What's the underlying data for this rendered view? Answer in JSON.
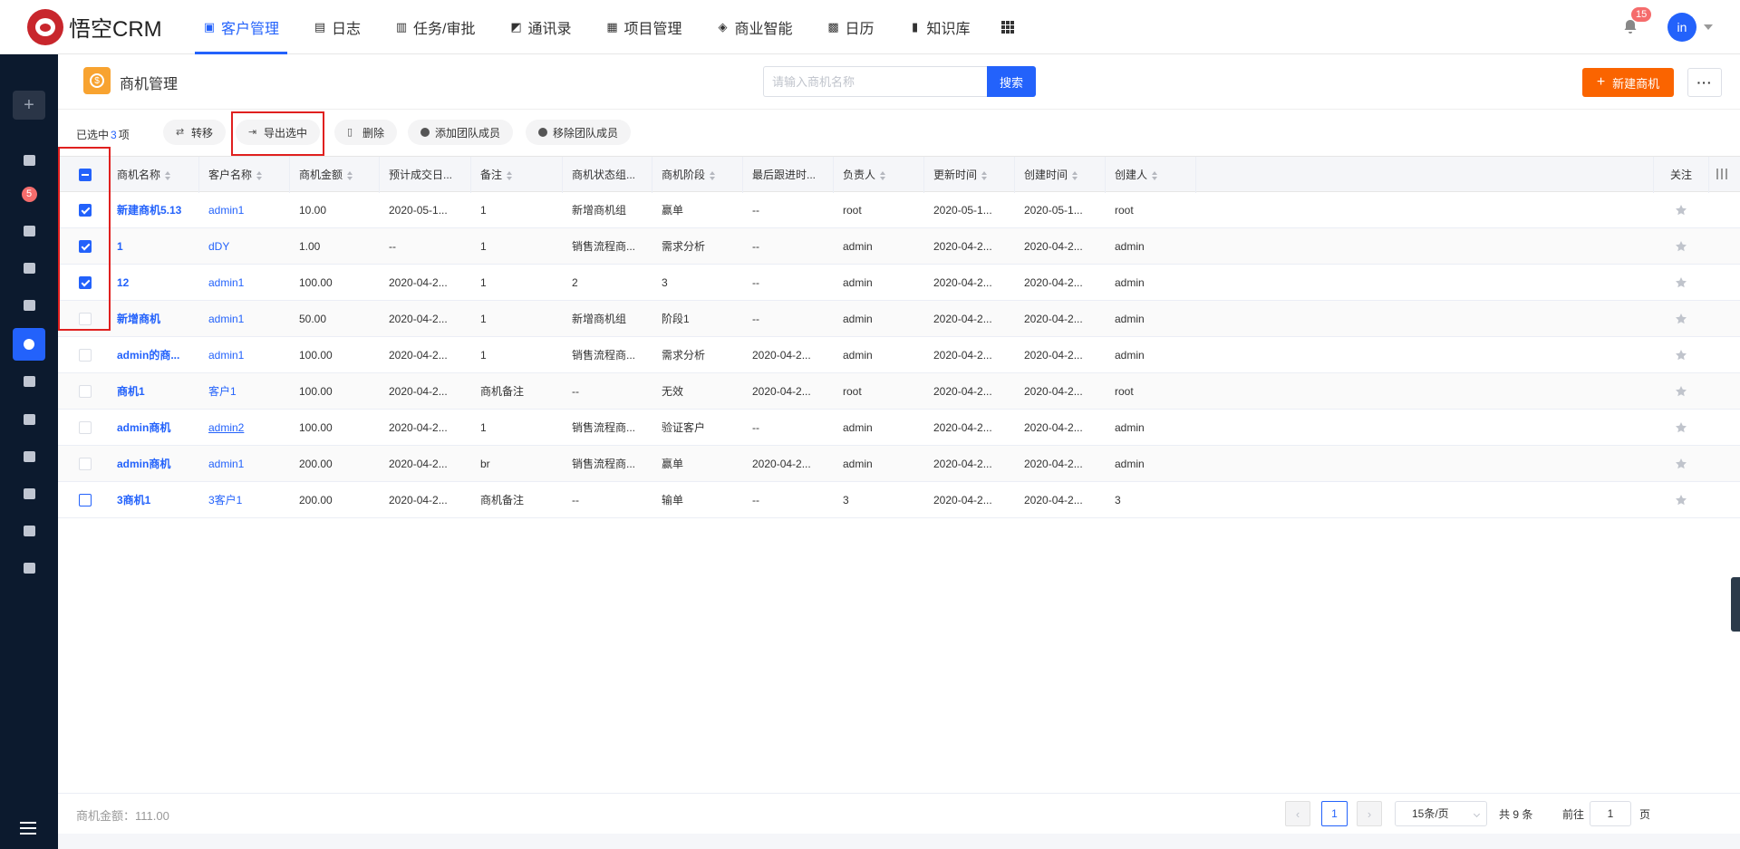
{
  "app": {
    "logo_text": "悟空CRM"
  },
  "nav": {
    "items": [
      {
        "label": "客户管理",
        "icon": "customer-icon",
        "active": true
      },
      {
        "label": "日志",
        "icon": "log-icon"
      },
      {
        "label": "任务/审批",
        "icon": "briefcase-icon"
      },
      {
        "label": "通讯录",
        "icon": "phone-book-icon"
      },
      {
        "label": "项目管理",
        "icon": "project-icon"
      },
      {
        "label": "商业智能",
        "icon": "bi-icon"
      },
      {
        "label": "日历",
        "icon": "calendar-icon"
      },
      {
        "label": "知识库",
        "icon": "book-icon"
      }
    ],
    "notification_count": "15",
    "avatar_text": "in"
  },
  "sidebar": {
    "add_label": "+",
    "badge_count": "5"
  },
  "header": {
    "title": "商机管理",
    "search_placeholder": "请输入商机名称",
    "search_button": "搜索",
    "new_button": "新建商机",
    "more_button": "···"
  },
  "toolbar": {
    "selected_prefix": "已选中",
    "selected_count": "3",
    "selected_suffix": "项",
    "buttons": [
      "转移",
      "导出选中",
      "删除",
      "添加团队成员",
      "移除团队成员"
    ]
  },
  "table": {
    "columns": [
      "商机名称",
      "客户名称",
      "商机金额",
      "预计成交日...",
      "备注",
      "商机状态组...",
      "商机阶段",
      "最后跟进时...",
      "负责人",
      "更新时间",
      "创建时间",
      "创建人",
      "关注"
    ],
    "rows": [
      {
        "checked": true,
        "cells": [
          "新建商机5.13",
          "admin1",
          "10.00",
          "2020-05-1...",
          "1",
          "新增商机组",
          "赢单",
          "--",
          "root",
          "2020-05-1...",
          "2020-05-1...",
          "root"
        ]
      },
      {
        "checked": true,
        "cells": [
          "1",
          "dDY",
          "1.00",
          "--",
          "1",
          "销售流程商...",
          "需求分析",
          "--",
          "admin",
          "2020-04-2...",
          "2020-04-2...",
          "admin"
        ]
      },
      {
        "checked": true,
        "cells": [
          "12",
          "admin1",
          "100.00",
          "2020-04-2...",
          "1",
          "2",
          "3",
          "--",
          "admin",
          "2020-04-2...",
          "2020-04-2...",
          "admin"
        ]
      },
      {
        "checked": false,
        "cells": [
          "新增商机",
          "admin1",
          "50.00",
          "2020-04-2...",
          "1",
          "新增商机组",
          "阶段1",
          "--",
          "admin",
          "2020-04-2...",
          "2020-04-2...",
          "admin"
        ]
      },
      {
        "checked": false,
        "cells": [
          "admin的商...",
          "admin1",
          "100.00",
          "2020-04-2...",
          "1",
          "销售流程商...",
          "需求分析",
          "2020-04-2...",
          "admin",
          "2020-04-2...",
          "2020-04-2...",
          "admin"
        ]
      },
      {
        "checked": false,
        "cells": [
          "商机1",
          "客户1",
          "100.00",
          "2020-04-2...",
          "商机备注",
          "--",
          "无效",
          "2020-04-2...",
          "root",
          "2020-04-2...",
          "2020-04-2...",
          "root"
        ]
      },
      {
        "checked": false,
        "cells": [
          "admin商机",
          "admin2",
          "100.00",
          "2020-04-2...",
          "1",
          "销售流程商...",
          "验证客户",
          "--",
          "admin",
          "2020-04-2...",
          "2020-04-2...",
          "admin"
        ]
      },
      {
        "checked": false,
        "cells": [
          "admin商机",
          "admin1",
          "200.00",
          "2020-04-2...",
          "br",
          "销售流程商...",
          "赢单",
          "2020-04-2...",
          "admin",
          "2020-04-2...",
          "2020-04-2...",
          "admin"
        ]
      },
      {
        "checked": false,
        "cells": [
          "3商机1",
          "3客户1",
          "200.00",
          "2020-04-2...",
          "商机备注",
          "--",
          "输单",
          "--",
          "3",
          "2020-04-2...",
          "2020-04-2...",
          "3"
        ]
      }
    ]
  },
  "footer": {
    "sum_label": "商机金额：111.00",
    "current_page": "1",
    "page_size": "15条/页",
    "total": "共 9 条",
    "goto_label": "前往",
    "goto_value": "1",
    "page_label": "页"
  },
  "colors": {
    "primary": "#2362fb",
    "accent": "#fa6400",
    "highlight": "#e0201f",
    "sidebar_bg": "#0c1a2e"
  }
}
